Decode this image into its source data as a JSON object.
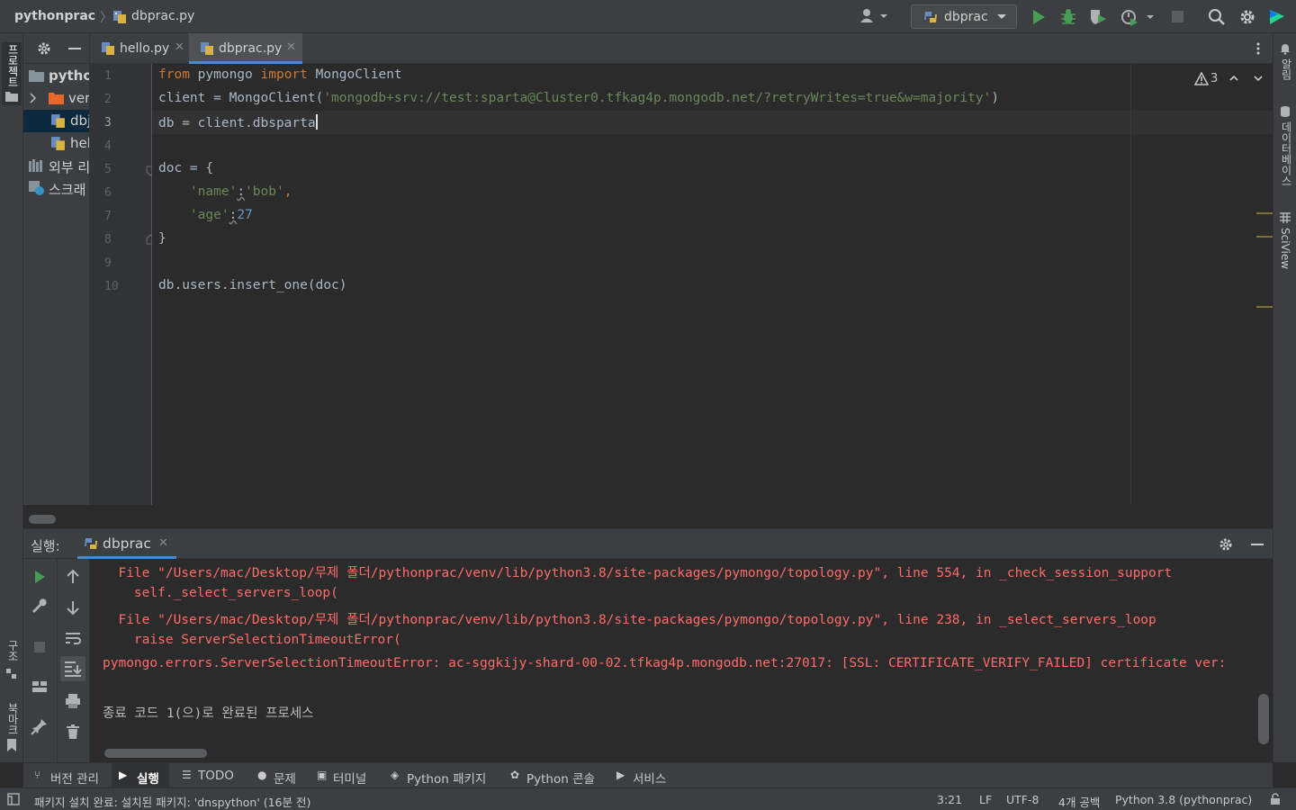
{
  "window": {
    "breadcrumb_project": "pythonprac",
    "breadcrumb_sep": "〉",
    "breadcrumb_file": "dbprac.py",
    "run_config": "dbprac"
  },
  "left_strip": {
    "project_label": "프로젝트",
    "structure_label": "구조",
    "bookmarks_label": "북마크"
  },
  "right_strip": {
    "notifications_label": "알림",
    "database_label": "데이터베이스",
    "sciview_label": "SciView"
  },
  "project_tree": [
    {
      "label": "pytho",
      "icon": "folder-icon"
    },
    {
      "label": "ver",
      "icon": "folder-icon"
    },
    {
      "label": "dbj",
      "icon": "python-file-icon"
    },
    {
      "label": "hel",
      "icon": "python-file-icon"
    },
    {
      "label": "외부 리",
      "icon": "library-icon"
    },
    {
      "label": "스크래",
      "icon": "scratch-icon"
    }
  ],
  "tabs": [
    {
      "label": "hello.py",
      "active": false
    },
    {
      "label": "dbprac.py",
      "active": true
    }
  ],
  "editor": {
    "line_numbers": [
      "1",
      "2",
      "3",
      "4",
      "5",
      "6",
      "7",
      "8",
      "9",
      "10"
    ],
    "current_line": "3",
    "code": {
      "l1_from": "from",
      "l1_mod": " pymongo ",
      "l1_import": "import",
      "l1_name": " MongoClient",
      "l2_pre": "client = MongoClient(",
      "l2_str": "'mongodb+srv://test:sparta@Cluster0.tfkag4p.mongodb.net/?retryWrites=true&w=majority'",
      "l2_post": ")",
      "l3": "db = client.dbsparta",
      "l5": "doc = {",
      "l6_key": "    'name'",
      "l6_colon": ":",
      "l6_val": "'bob'",
      "l6_comma": ",",
      "l7_key": "    'age'",
      "l7_colon": ":",
      "l7_val": "27",
      "l8": "}",
      "l10": "db.users.insert_one(doc)"
    },
    "warnings_count": "3"
  },
  "run_panel": {
    "title": "실행:",
    "tab_label": "dbprac",
    "console_lines": [
      {
        "text": "  File \"/Users/mac/Desktop/무제 폴더/pythonprac/venv/lib/python3.8/site-packages/pymongo/topology.py\", line 554, in _check_session_support",
        "kind": "err"
      },
      {
        "text": "    self._select_servers_loop(",
        "kind": "err"
      },
      {
        "text": "  File \"/Users/mac/Desktop/무제 폴더/pythonprac/venv/lib/python3.8/site-packages/pymongo/topology.py\", line 238, in _select_servers_loop",
        "kind": "err"
      },
      {
        "text": "    raise ServerSelectionTimeoutError(",
        "kind": "err"
      },
      {
        "text": "pymongo.errors.ServerSelectionTimeoutError: ac-sggkijy-shard-00-02.tfkag4p.mongodb.net:27017: [SSL: CERTIFICATE_VERIFY_FAILED] certificate ver:",
        "kind": "err"
      },
      {
        "text": "",
        "kind": "normal"
      },
      {
        "text": "종료 코드 1(으)로 완료된 프로세스",
        "kind": "normal"
      }
    ]
  },
  "bottom_tools": [
    {
      "label": "버전 관리",
      "icon": "vcs-icon",
      "active": false
    },
    {
      "label": "실행",
      "icon": "run-icon",
      "active": true
    },
    {
      "label": "TODO",
      "icon": "todo-icon",
      "active": false
    },
    {
      "label": "문제",
      "icon": "problems-icon",
      "active": false
    },
    {
      "label": "터미널",
      "icon": "terminal-icon",
      "active": false
    },
    {
      "label": "Python 패키지",
      "icon": "packages-icon",
      "active": false
    },
    {
      "label": "Python 콘솔",
      "icon": "python-console-icon",
      "active": false
    },
    {
      "label": "서비스",
      "icon": "services-icon",
      "active": false
    }
  ],
  "status": {
    "message": "패키지 설치 완료: 설치된 패키지: 'dnspython' (16분 전)",
    "position": "3:21",
    "line_sep": "LF",
    "encoding": "UTF-8",
    "indent": "4개 공백",
    "interpreter": "Python 3.8 (pythonprac)"
  },
  "colors": {
    "accent": "#4a88c7",
    "error_text": "#ff6b68",
    "keyword": "#cc7832",
    "string": "#6a8759",
    "number": "#6897bb",
    "run_green": "#499c54"
  }
}
